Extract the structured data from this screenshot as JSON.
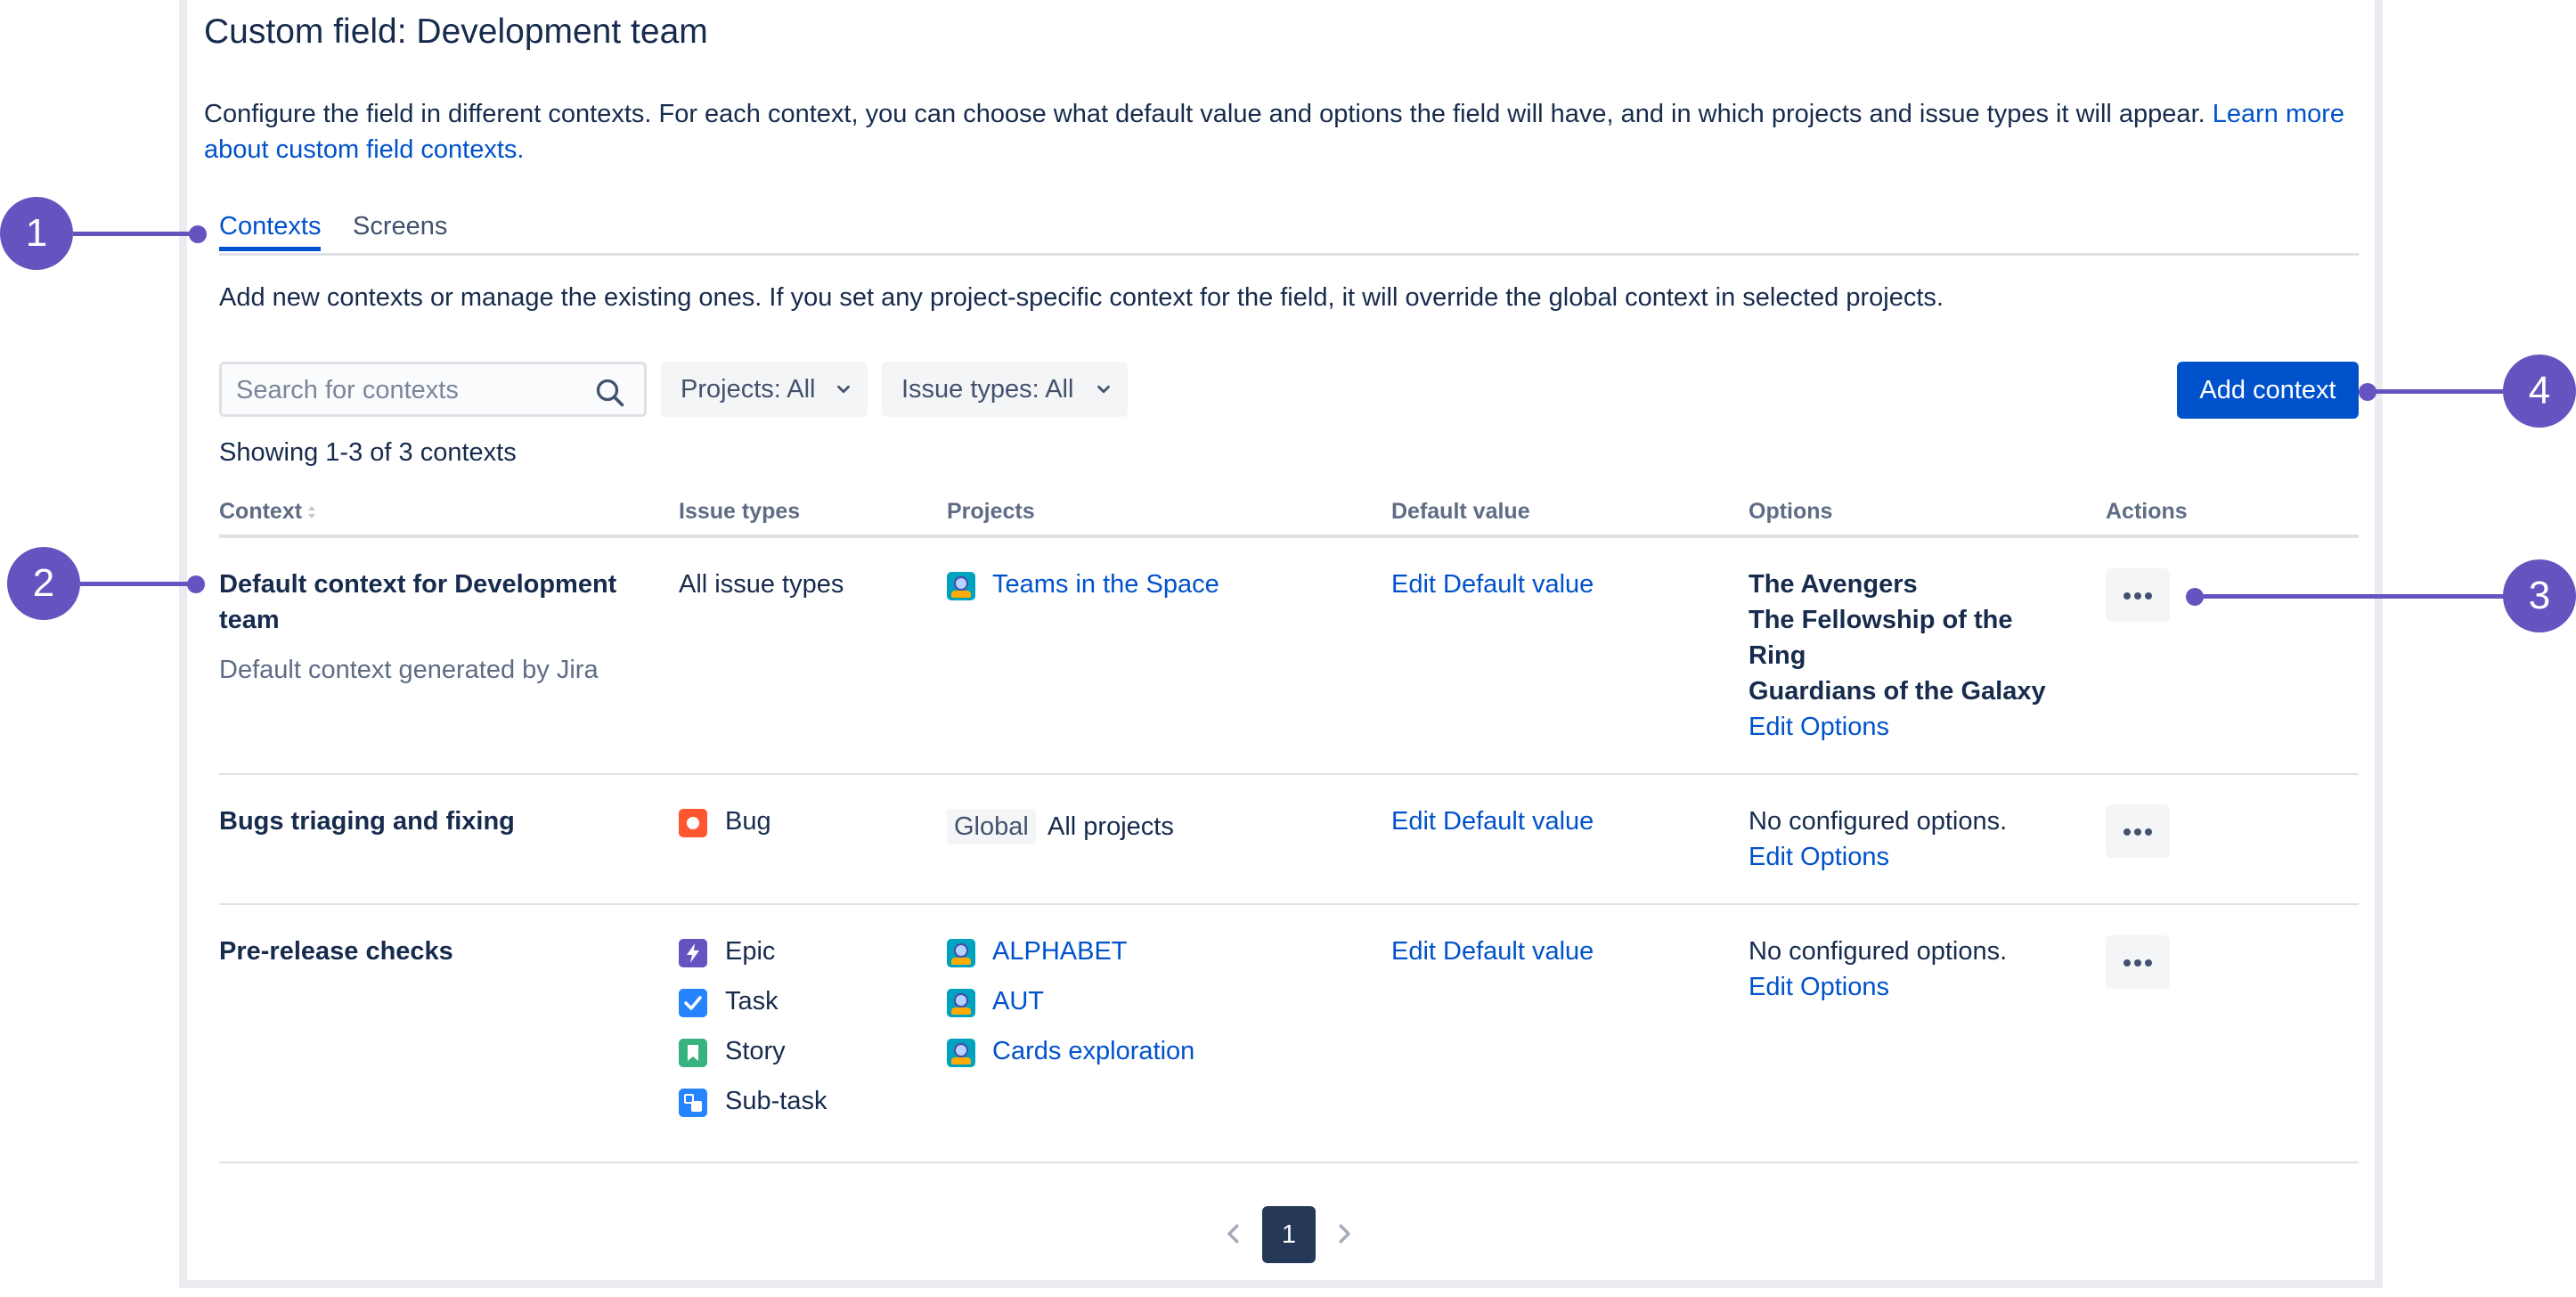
{
  "page": {
    "title": "Custom field: Development team",
    "description": "Configure the field in different contexts. For each context, you can choose what default value and options the field will have, and in which projects and issue types it will appear.",
    "learn_more": "Learn more about custom field contexts."
  },
  "tabs": [
    {
      "label": "Contexts",
      "active": true
    },
    {
      "label": "Screens",
      "active": false
    }
  ],
  "contexts_description": "Add new contexts or manage the existing ones. If you set any project-specific context for the field, it will override the global context in selected projects.",
  "toolbar": {
    "search_placeholder": "Search for contexts",
    "projects_filter": "Projects: All",
    "issue_types_filter": "Issue types: All",
    "add_context": "Add context"
  },
  "showing": "Showing 1-3 of 3 contexts",
  "table": {
    "headers": [
      "Context",
      "Issue types",
      "Projects",
      "Default value",
      "Options",
      "Actions"
    ],
    "rows": [
      {
        "name_line1": "Default context for Development",
        "name_line2": "team",
        "subtitle": "Default context generated by Jira",
        "issue_types": [
          {
            "label": "All issue types",
            "icon": ""
          }
        ],
        "projects": [
          {
            "label": "Teams in the Space",
            "icon": "project-avatar-icon"
          }
        ],
        "default_value": "Edit Default value",
        "options": [
          "The Avengers",
          "The Fellowship of the",
          "Ring",
          "Guardians of the Galaxy"
        ],
        "edit_options": "Edit Options"
      },
      {
        "name_line1": "Bugs triaging and fixing",
        "issue_types": [
          {
            "label": "Bug",
            "icon": "bug-icon",
            "color": "#ff5630"
          }
        ],
        "projects_global_badge": "Global",
        "projects_all": "All projects",
        "default_value": "Edit Default value",
        "options_text": "No configured options.",
        "edit_options": "Edit Options"
      },
      {
        "name_line1": "Pre-release checks",
        "issue_types": [
          {
            "label": "Epic",
            "icon": "epic-icon",
            "color": "#6554c0"
          },
          {
            "label": "Task",
            "icon": "task-icon",
            "color": "#2684ff"
          },
          {
            "label": "Story",
            "icon": "story-icon",
            "color": "#36b37e"
          },
          {
            "label": "Sub-task",
            "icon": "subtask-icon",
            "color": "#2684ff"
          }
        ],
        "projects": [
          {
            "label": "ALPHABET",
            "icon": "project-avatar-icon"
          },
          {
            "label": "AUT",
            "icon": "project-avatar-icon"
          },
          {
            "label": "Cards exploration",
            "icon": "project-avatar-icon"
          }
        ],
        "default_value": "Edit Default value",
        "options_text": "No configured options.",
        "edit_options": "Edit Options"
      }
    ]
  },
  "pagination": {
    "current": "1"
  },
  "callouts": [
    "1",
    "2",
    "3",
    "4"
  ],
  "colors": {
    "primary": "#0052cc",
    "callout": "#6554c0",
    "text": "#172b4d"
  }
}
